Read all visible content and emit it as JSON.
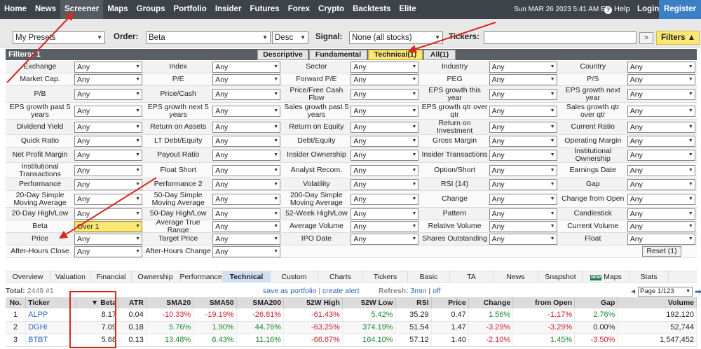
{
  "colors": {
    "nav_bg": "#3e4349",
    "register_bg": "#3b7fc4",
    "highlight": "#fbe774",
    "annotation": "#d7281e",
    "link": "#2a64b8",
    "positive": "#1b8a2e",
    "negative": "#d0202a"
  },
  "nav": {
    "items": [
      "Home",
      "News",
      "Screener",
      "Maps",
      "Groups",
      "Portfolio",
      "Insider",
      "Futures",
      "Forex",
      "Crypto",
      "Backtests",
      "Elite"
    ],
    "active": "Screener",
    "datetime": "Sun MAR 26 2023 5:41 AM ET",
    "help": "Help",
    "login": "Login",
    "register": "Register"
  },
  "settings": {
    "presets": "My Presets",
    "order_label": "Order:",
    "order_value": "Beta",
    "direction": "Desc",
    "signal_label": "Signal:",
    "signal_value": "None (all stocks)",
    "tickers_label": "Tickers:",
    "tickers_value": "",
    "go": ">",
    "filters_button": "Filters ▲"
  },
  "filter_tabs": {
    "count_label": "Filters: 1",
    "tabs": [
      "Descriptive",
      "Fundamental",
      "Technical(1)",
      "All(1)"
    ],
    "active": "Technical(1)"
  },
  "filters": [
    [
      [
        "Exchange",
        "Any"
      ],
      [
        "Index",
        "Any"
      ],
      [
        "Sector",
        "Any"
      ],
      [
        "Industry",
        "Any"
      ],
      [
        "Country",
        "Any"
      ]
    ],
    [
      [
        "Market Cap.",
        "Any"
      ],
      [
        "P/E",
        "Any"
      ],
      [
        "Forward P/E",
        "Any"
      ],
      [
        "PEG",
        "Any"
      ],
      [
        "P/S",
        "Any"
      ]
    ],
    [
      [
        "P/B",
        "Any"
      ],
      [
        "Price/Cash",
        "Any"
      ],
      [
        "Price/Free Cash Flow",
        "Any"
      ],
      [
        "EPS growth this year",
        "Any"
      ],
      [
        "EPS growth next year",
        "Any"
      ]
    ],
    [
      [
        "EPS growth past 5 years",
        "Any"
      ],
      [
        "EPS growth next 5 years",
        "Any"
      ],
      [
        "Sales growth past 5 years",
        "Any"
      ],
      [
        "EPS growth qtr over qtr",
        "Any"
      ],
      [
        "Sales growth qtr over qtr",
        "Any"
      ]
    ],
    [
      [
        "Dividend Yield",
        "Any"
      ],
      [
        "Return on Assets",
        "Any"
      ],
      [
        "Return on Equity",
        "Any"
      ],
      [
        "Return on Investment",
        "Any"
      ],
      [
        "Current Ratio",
        "Any"
      ]
    ],
    [
      [
        "Quick Ratio",
        "Any"
      ],
      [
        "LT Debt/Equity",
        "Any"
      ],
      [
        "Debt/Equity",
        "Any"
      ],
      [
        "Gross Margin",
        "Any"
      ],
      [
        "Operating Margin",
        "Any"
      ]
    ],
    [
      [
        "Net Profit Margin",
        "Any"
      ],
      [
        "Payout Ratio",
        "Any"
      ],
      [
        "Insider Ownership",
        "Any"
      ],
      [
        "Insider Transactions",
        "Any"
      ],
      [
        "Institutional Ownership",
        "Any"
      ]
    ],
    [
      [
        "Institutional Transactions",
        "Any"
      ],
      [
        "Float Short",
        "Any"
      ],
      [
        "Analyst Recom.",
        "Any"
      ],
      [
        "Option/Short",
        "Any"
      ],
      [
        "Earnings Date",
        "Any"
      ]
    ],
    [
      [
        "Performance",
        "Any"
      ],
      [
        "Performance 2",
        "Any"
      ],
      [
        "Volatility",
        "Any"
      ],
      [
        "RSI (14)",
        "Any"
      ],
      [
        "Gap",
        "Any"
      ]
    ],
    [
      [
        "20-Day Simple Moving Average",
        "Any"
      ],
      [
        "50-Day Simple Moving Average",
        "Any"
      ],
      [
        "200-Day Simple Moving Average",
        "Any"
      ],
      [
        "Change",
        "Any"
      ],
      [
        "Change from Open",
        "Any"
      ]
    ],
    [
      [
        "20-Day High/Low",
        "Any"
      ],
      [
        "50-Day High/Low",
        "Any"
      ],
      [
        "52-Week High/Low",
        "Any"
      ],
      [
        "Pattern",
        "Any"
      ],
      [
        "Candlestick",
        "Any"
      ]
    ],
    [
      [
        "Beta",
        "Over 1"
      ],
      [
        "Average True Range",
        "Any"
      ],
      [
        "Average Volume",
        "Any"
      ],
      [
        "Relative Volume",
        "Any"
      ],
      [
        "Current Volume",
        "Any"
      ]
    ],
    [
      [
        "Price",
        "Any"
      ],
      [
        "Target Price",
        "Any"
      ],
      [
        "IPO Date",
        "Any"
      ],
      [
        "Shares Outstanding",
        "Any"
      ],
      [
        "Float",
        "Any"
      ]
    ],
    [
      [
        "After-Hours Close",
        "Any"
      ],
      [
        "After-Hours Change",
        "Any"
      ]
    ]
  ],
  "reset_label": "Reset (1)",
  "view_tabs": {
    "tabs": [
      "Overview",
      "Valuation",
      "Financial",
      "Ownership",
      "Performance",
      "Technical",
      "Custom",
      "Charts",
      "Tickers",
      "Basic",
      "TA",
      "News",
      "Snapshot",
      "Maps",
      "Stats"
    ],
    "active": "Technical",
    "new_badge": "NEW"
  },
  "results_info": {
    "total_label": "Total:",
    "total_value": "2449 #1",
    "save_portfolio": "save as portfolio",
    "separator": "|",
    "create_alert": "create alert",
    "refresh_label": "Refresh:",
    "refresh_interval": "3min",
    "refresh_separator": "|",
    "refresh_off": "off",
    "page": "Page 1/123"
  },
  "table": {
    "headers": [
      "No.",
      "Ticker",
      "▼ Beta",
      "ATR",
      "SMA20",
      "SMA50",
      "SMA200",
      "52W High",
      "52W Low",
      "RSI",
      "Price",
      "Change",
      "from Open",
      "Gap",
      "Volume"
    ],
    "rows": [
      [
        "1",
        "ALPP",
        "8.17",
        "0.04",
        "-10.33%",
        "-19.19%",
        "-26.81%",
        "-61.43%",
        "5.42%",
        "35.29",
        "0.47",
        "1.56%",
        "-1.17%",
        "2.76%",
        "192,120"
      ],
      [
        "2",
        "DGHI",
        "7.09",
        "0.18",
        "5.76%",
        "1.90%",
        "44.76%",
        "-63.25%",
        "374.19%",
        "51.54",
        "1.47",
        "-3.29%",
        "-3.29%",
        "0.00%",
        "52,744"
      ],
      [
        "3",
        "BTBT",
        "5.68",
        "0.13",
        "13.48%",
        "6.43%",
        "11.16%",
        "-66.67%",
        "164.10%",
        "57.12",
        "1.40",
        "-2.10%",
        "1.45%",
        "-3.50%",
        "1,547,452"
      ]
    ]
  }
}
